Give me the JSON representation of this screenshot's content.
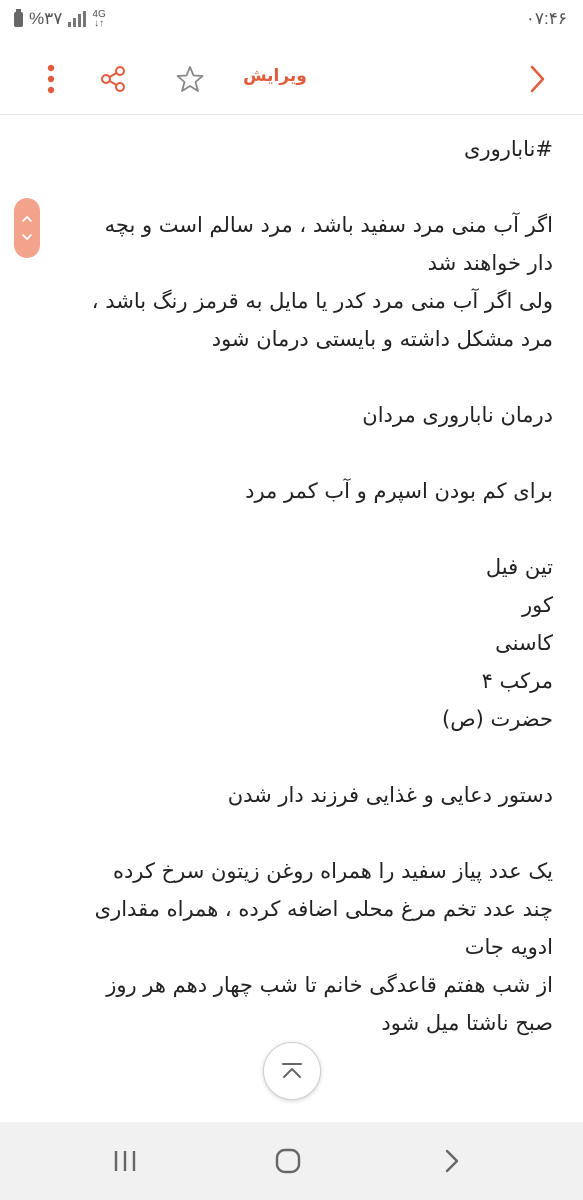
{
  "status_bar": {
    "time": "۰۷:۴۶",
    "battery": "%۳۷",
    "network": "4G"
  },
  "toolbar": {
    "edit_label": "ویرایش"
  },
  "note": {
    "lines": [
      "#ناباروری",
      "",
      "اگر آب منی مرد سفید باشد ، مرد سالم است و بچه",
      "دار خواهند شد",
      "ولی اگر آب منی مرد کدر یا مایل به قرمز  رنگ باشد ،",
      "مرد مشکل داشته و بایستی درمان شود",
      "",
      "درمان ناباروری مردان",
      "",
      "برای کم بودن اسپرم و آب کمر مرد",
      "",
      "تین فیل",
      "کور",
      "کاسنی",
      "مرکب ۴",
      "حضرت (ص)",
      "",
      "دستور دعایی و غذایی فرزند دار شدن",
      "",
      "یک عدد پیاز سفید را همراه روغن زیتون سرخ کرده",
      "چند عدد تخم مرغ محلی اضافه کرده ، همراه مقداری",
      "ادویه جات",
      "از شب هفتم قاعدگی خانم تا شب چهار دهم هر روز",
      "صبح ناشتا میل شود"
    ]
  },
  "colors": {
    "accent": "#e25b3c",
    "pill": "#f3a28c",
    "navbar": "#f1f1f1"
  },
  "icons": [
    "back-icon",
    "star-icon",
    "share-icon",
    "more-icon",
    "scroll-up-down-icon",
    "scroll-to-top-icon",
    "recents-icon",
    "home-icon",
    "nav-back-icon"
  ]
}
